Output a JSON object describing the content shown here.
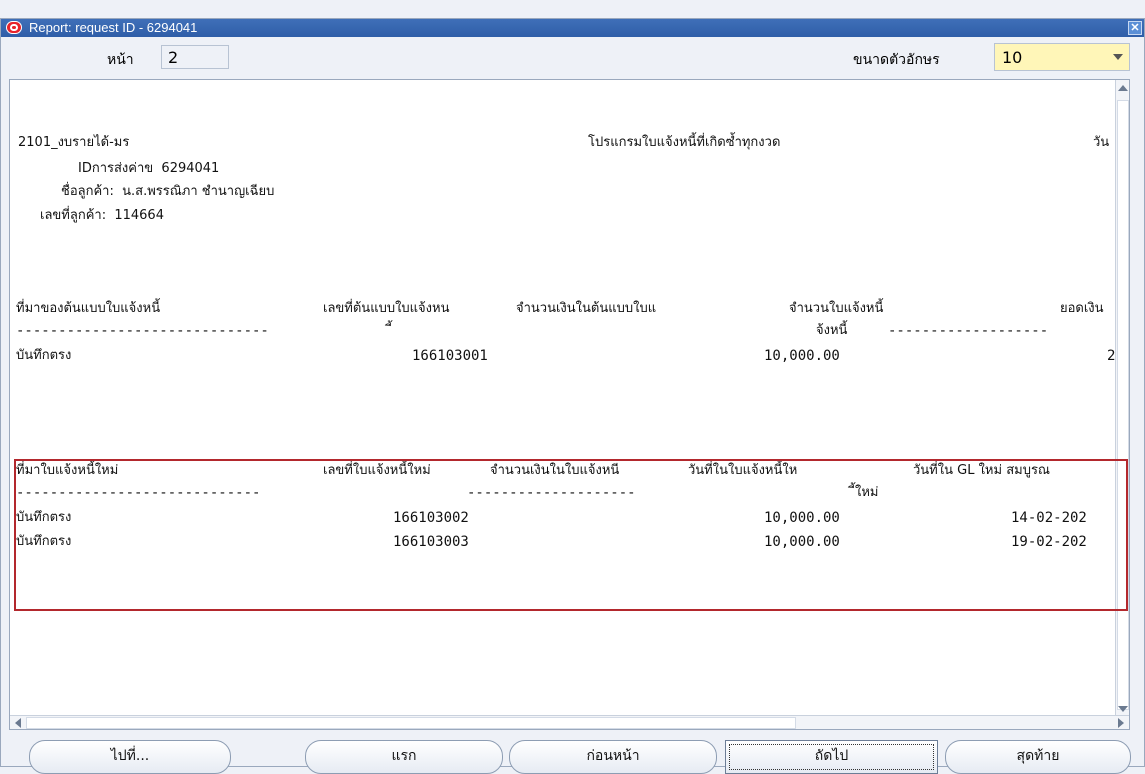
{
  "window": {
    "title": "Report: request ID - 6294041",
    "close_glyph": "✕"
  },
  "toolbar": {
    "page_label": "หน้า",
    "page_value": "2",
    "font_label": "ขนาดตัวอักษร",
    "font_value": "10"
  },
  "report": {
    "header": {
      "line1_left": "2101_งบรายได้-มร",
      "line1_center": "โปรแกรมใบแจ้งหนี้ที่เกิดซ้ำทุกงวด",
      "line1_right": "วัน",
      "line2": "IDการส่งค่าข  6294041",
      "line3": "ชื่อลูกค้า:  น.ส.พรรณิภา ชำนาญเฉียบ",
      "line4": "เลขที่ลูกค้า:  114664"
    },
    "section1": {
      "col1": "ที่มาของต้นแบบใบแจ้งหนี้",
      "col2": "เลขที่ต้นแบบใบแจ้งหน",
      "col3": "จำนวนเงินในต้นแบบใบแ",
      "col4": "จำนวนใบแจ้งหนี้",
      "col5": "ยอดเงิน",
      "wrap1": "ี้",
      "wrap2": "จ้งหนี้",
      "dashes_a": "------------------------------",
      "dashes_b": "-------------------",
      "row1": {
        "source": "บันทึกตรง",
        "number": "166103001",
        "amount": "10,000.00",
        "tail": "2"
      }
    },
    "section2": {
      "col1": "ที่มาใบแจ้งหนี้ใหม่",
      "col2": "เลขที่ใบแจ้งหนี้ใหม่",
      "col3": "จำนวนเงินในใบแจ้งหนี",
      "col4": "วันที่ในใบแจ้งหนี้ให",
      "col5": "วันที่ใน GL ใหม่ สมบูรณ",
      "wrap1": "ี้ใหม่",
      "dashes_a": "-----------------------------",
      "dashes_b": "--------------------",
      "rows": [
        {
          "source": "บันทึกตรง",
          "number": "166103002",
          "amount": "10,000.00",
          "date": "14-02-202"
        },
        {
          "source": "บันทึกตรง",
          "number": "166103003",
          "amount": "10,000.00",
          "date": "19-02-202"
        }
      ]
    }
  },
  "buttons": {
    "goto": "ไปที่...",
    "first": "แรก",
    "previous": "ก่อนหน้า",
    "next": "ถัดไป",
    "last": "สุดท้าย"
  },
  "colors": {
    "highlight": "#b3282d",
    "font_select_bg": "#fff6b8",
    "titlebar": "#2f5ea8"
  }
}
